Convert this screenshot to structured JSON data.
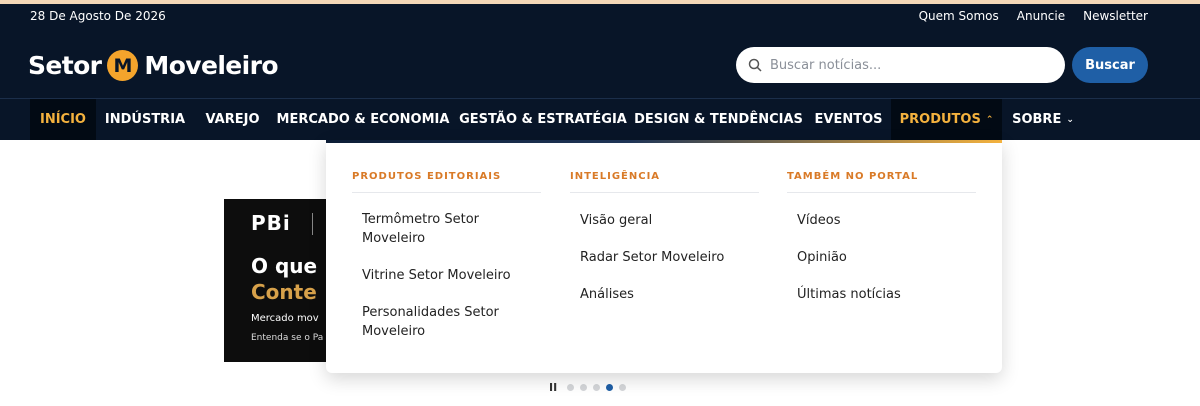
{
  "topbar": {
    "date": "28 De Agosto De 2026",
    "links": [
      "Quem Somos",
      "Anuncie",
      "Newsletter"
    ]
  },
  "header": {
    "logo_left": "Setor",
    "logo_mark": "M",
    "logo_right": "Moveleiro",
    "search_placeholder": "Buscar notícias...",
    "search_button": "Buscar"
  },
  "nav": {
    "items": [
      {
        "label": "INÍCIO"
      },
      {
        "label": "INDÚSTRIA"
      },
      {
        "label": "VAREJO"
      },
      {
        "label": "MERCADO & ECONOMIA"
      },
      {
        "label": "GESTÃO & ESTRATÉGIA"
      },
      {
        "label": "DESIGN & TENDÊNCIAS"
      },
      {
        "label": "EVENTOS"
      },
      {
        "label": "PRODUTOS",
        "caret": "⌃"
      },
      {
        "label": "SOBRE",
        "caret": "⌄"
      }
    ]
  },
  "dropdown": {
    "columns": [
      {
        "title": "PRODUTOS EDITORIAIS",
        "items": [
          "Termômetro Setor Moveleiro",
          "Vitrine Setor Moveleiro",
          "Personalidades Setor Moveleiro"
        ]
      },
      {
        "title": "INTELIGÊNCIA",
        "items": [
          "Visão geral",
          "Radar Setor Moveleiro",
          "Análises"
        ]
      },
      {
        "title": "TAMBÉM NO PORTAL",
        "items": [
          "Vídeos",
          "Opinião",
          "Últimas notícias"
        ]
      }
    ]
  },
  "banner": {
    "brand": "PBi",
    "line1": "O que",
    "line2": "Conte",
    "line3": "Mercado mov",
    "line4": "Entenda se o Pa"
  },
  "carousel": {
    "pause_icon": "pause-icon",
    "pause_glyph": "II",
    "dot_count": 5,
    "active_index": 3
  },
  "colors": {
    "nav_bg": "#081528",
    "accent": "#f4b23e",
    "button": "#1f5fa6",
    "section_title": "#d97a27"
  }
}
